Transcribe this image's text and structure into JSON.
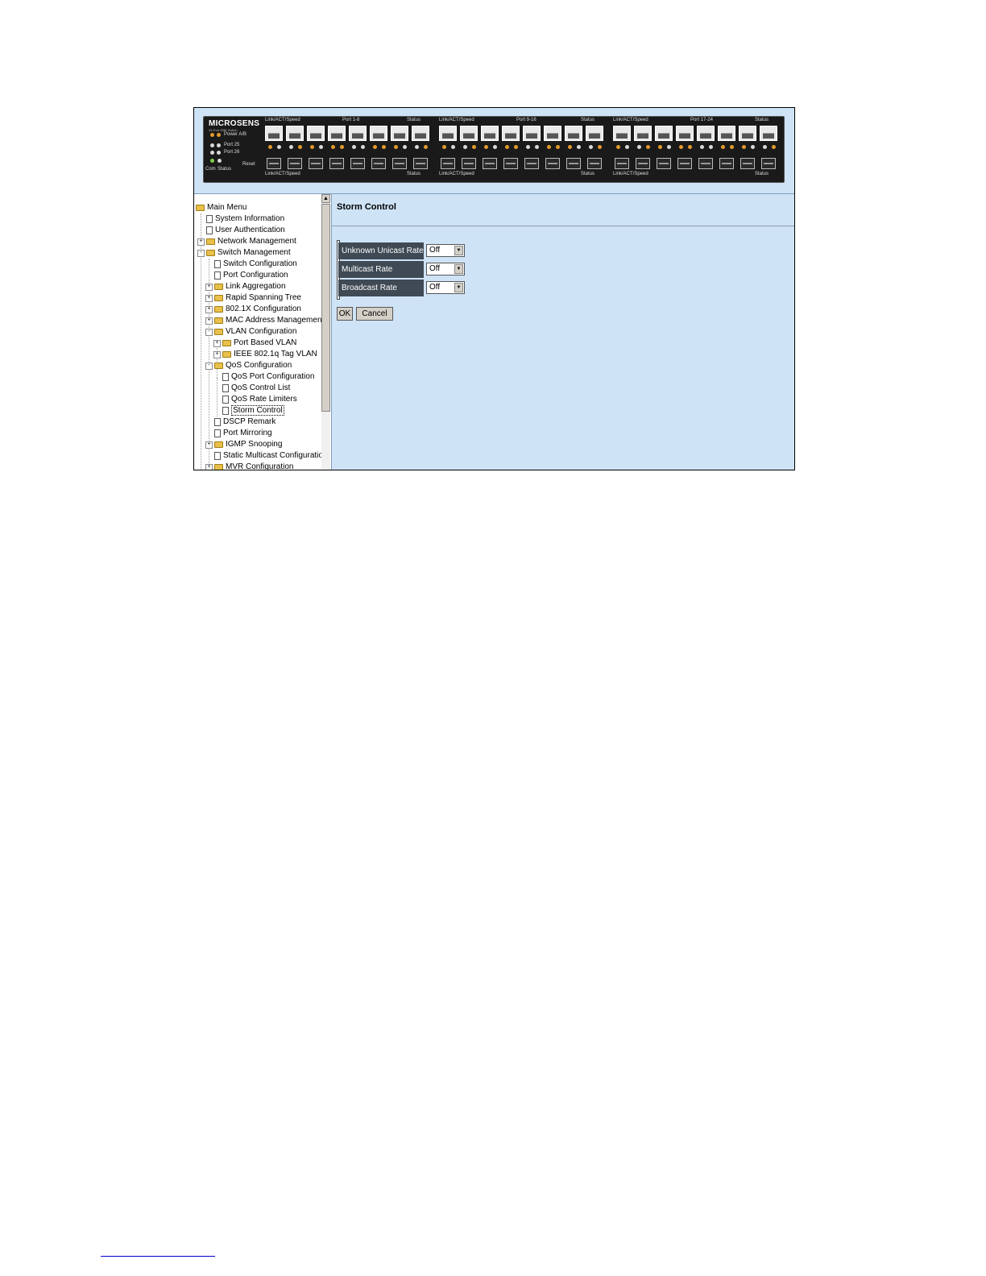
{
  "header": {
    "brand": "MICROSENS",
    "brand_sub": "24-Port GBE Switch",
    "power_label": "Power A/B",
    "port25_label": "Port 25",
    "port26_label": "Port 26",
    "com_label": "Com",
    "status_label": "Status",
    "reset_label": "Reset",
    "groups": [
      {
        "top_left": "Link/ACT/Speed",
        "top_mid": "Port 1-8",
        "top_right": "Status",
        "bottom_left": "Link/ACT/Speed",
        "bottom_right": "Status"
      },
      {
        "top_left": "Link/ACT/Speed",
        "top_mid": "Port 9-16",
        "top_right": "Status",
        "bottom_left": "Link/ACT/Speed",
        "bottom_right": "Status"
      },
      {
        "top_left": "Link/ACT/Speed",
        "top_mid": "Port 17-24",
        "top_right": "Status",
        "bottom_left": "Link/ACT/Speed",
        "bottom_right": "Status"
      }
    ]
  },
  "tree": {
    "items": [
      {
        "label": "Main Menu",
        "icon": "folder-open-icon"
      },
      {
        "label": "System Information",
        "icon": "document-icon"
      },
      {
        "label": "User Authentication",
        "icon": "document-icon"
      },
      {
        "label": "Network Management",
        "icon": "folder-icon"
      },
      {
        "label": "Switch Management",
        "icon": "folder-open-icon"
      },
      {
        "label": "Switch Configuration",
        "icon": "document-icon"
      },
      {
        "label": "Port Configuration",
        "icon": "document-icon"
      },
      {
        "label": "Link Aggregation",
        "icon": "folder-icon"
      },
      {
        "label": "Rapid Spanning Tree",
        "icon": "folder-icon"
      },
      {
        "label": "802.1X Configuration",
        "icon": "folder-icon"
      },
      {
        "label": "MAC Address Managemen",
        "icon": "folder-icon"
      },
      {
        "label": "VLAN Configuration",
        "icon": "folder-open-icon"
      },
      {
        "label": "Port Based VLAN",
        "icon": "folder-icon"
      },
      {
        "label": "IEEE 802.1q Tag VLAN",
        "icon": "folder-icon"
      },
      {
        "label": "QoS Configuration",
        "icon": "folder-open-icon"
      },
      {
        "label": "QoS Port Configuration",
        "icon": "document-icon"
      },
      {
        "label": "QoS Control List",
        "icon": "document-icon"
      },
      {
        "label": "QoS Rate Limiters",
        "icon": "document-icon"
      },
      {
        "label": "Storm Control",
        "icon": "document-icon",
        "selected": true
      },
      {
        "label": "DSCP Remark",
        "icon": "document-icon"
      },
      {
        "label": "Port Mirroring",
        "icon": "document-icon"
      },
      {
        "label": "IGMP Snooping",
        "icon": "folder-icon"
      },
      {
        "label": "Static Multicast Configuratio",
        "icon": "document-icon"
      },
      {
        "label": "MVR Configuration",
        "icon": "folder-icon"
      }
    ]
  },
  "content": {
    "title": "Storm Control",
    "rows": [
      {
        "label": "Unknown Unicast Rate",
        "value": "Off"
      },
      {
        "label": "Multicast Rate",
        "value": "Off"
      },
      {
        "label": "Broadcast Rate",
        "value": "Off"
      }
    ],
    "ok_label": "OK",
    "cancel_label": "Cancel"
  },
  "colors": {
    "page_background": "#cfe3f7",
    "row_label_background": "#3f4a55",
    "faceplate": "#1a1a1a",
    "led_amber": "#e39a2c"
  }
}
